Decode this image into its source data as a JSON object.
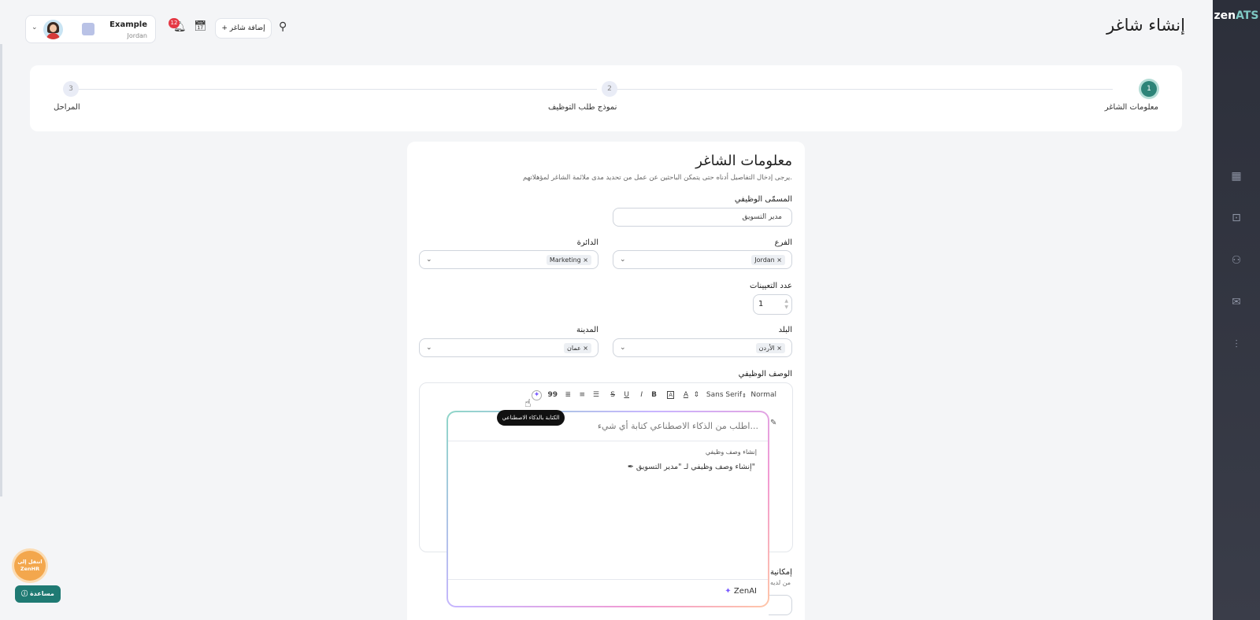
{
  "app": {
    "logo_main": "zen",
    "logo_accent": "ATS",
    "page_title": "إنشاء شاغر"
  },
  "sidebar": {
    "icons": [
      "grid-icon",
      "briefcase-icon",
      "users-icon",
      "mail-icon",
      "chart-icon"
    ]
  },
  "topbar": {
    "company_name": "Example",
    "company_country": "Jordan",
    "notification_count": "12",
    "add_vacancy_label": "+ إضافة شاغر"
  },
  "stepper": {
    "steps": [
      {
        "number": "1",
        "label": "معلومات الشاغر",
        "active": true
      },
      {
        "number": "2",
        "label": "نموذج طلب التوظيف",
        "active": false
      },
      {
        "number": "3",
        "label": "المراحل",
        "active": false
      }
    ]
  },
  "form": {
    "title": "معلومات الشاغر",
    "subtitle": "يرجى إدخال التفاصيل أدناه حتى يتمكن الباحثين عن عمل من تحديد مدى ملائمة الشاغر لمؤهلاتهم.",
    "job_title_label": "المسمّى الوظيفي",
    "job_title_value": "مدير التسويق",
    "branch_label": "الفرع",
    "branch_value": "Jordan",
    "department_label": "الدائرة",
    "department_value": "Marketing",
    "openings_label": "عدد التعيينات",
    "openings_value": "1",
    "country_label": "البلد",
    "country_value": "الأردن",
    "city_label": "المدينة",
    "city_value": "عمان",
    "description_label": "الوصف الوظيفي",
    "partial_label": "إمكانية",
    "partial_sub": "من لديه"
  },
  "editor_toolbar": {
    "heading": "Normal",
    "font": "Sans Serif",
    "bold": "B",
    "italic": "I",
    "underline": "U",
    "strike": "S",
    "quote": "99"
  },
  "ai": {
    "tooltip": "الكتابة بالذكاء الاصطناعي",
    "input_placeholder": "اطلب من الذكاء الاصطناعي كتابة أي شيء...",
    "section_title": "إنشاء وصف وظيفي",
    "suggestion": "إنشاء وصف وظيفي لـ \"مدير التسويق\"",
    "brand": "ZenAI"
  },
  "floating": {
    "zenhr_label": "انتقل إلى ZenHR",
    "help_label": "مساعدة"
  },
  "colors": {
    "primary": "#2d8478",
    "badge": "#e53945",
    "sidebar": "#2c2f3a",
    "zenhr": "#f3a74d"
  }
}
